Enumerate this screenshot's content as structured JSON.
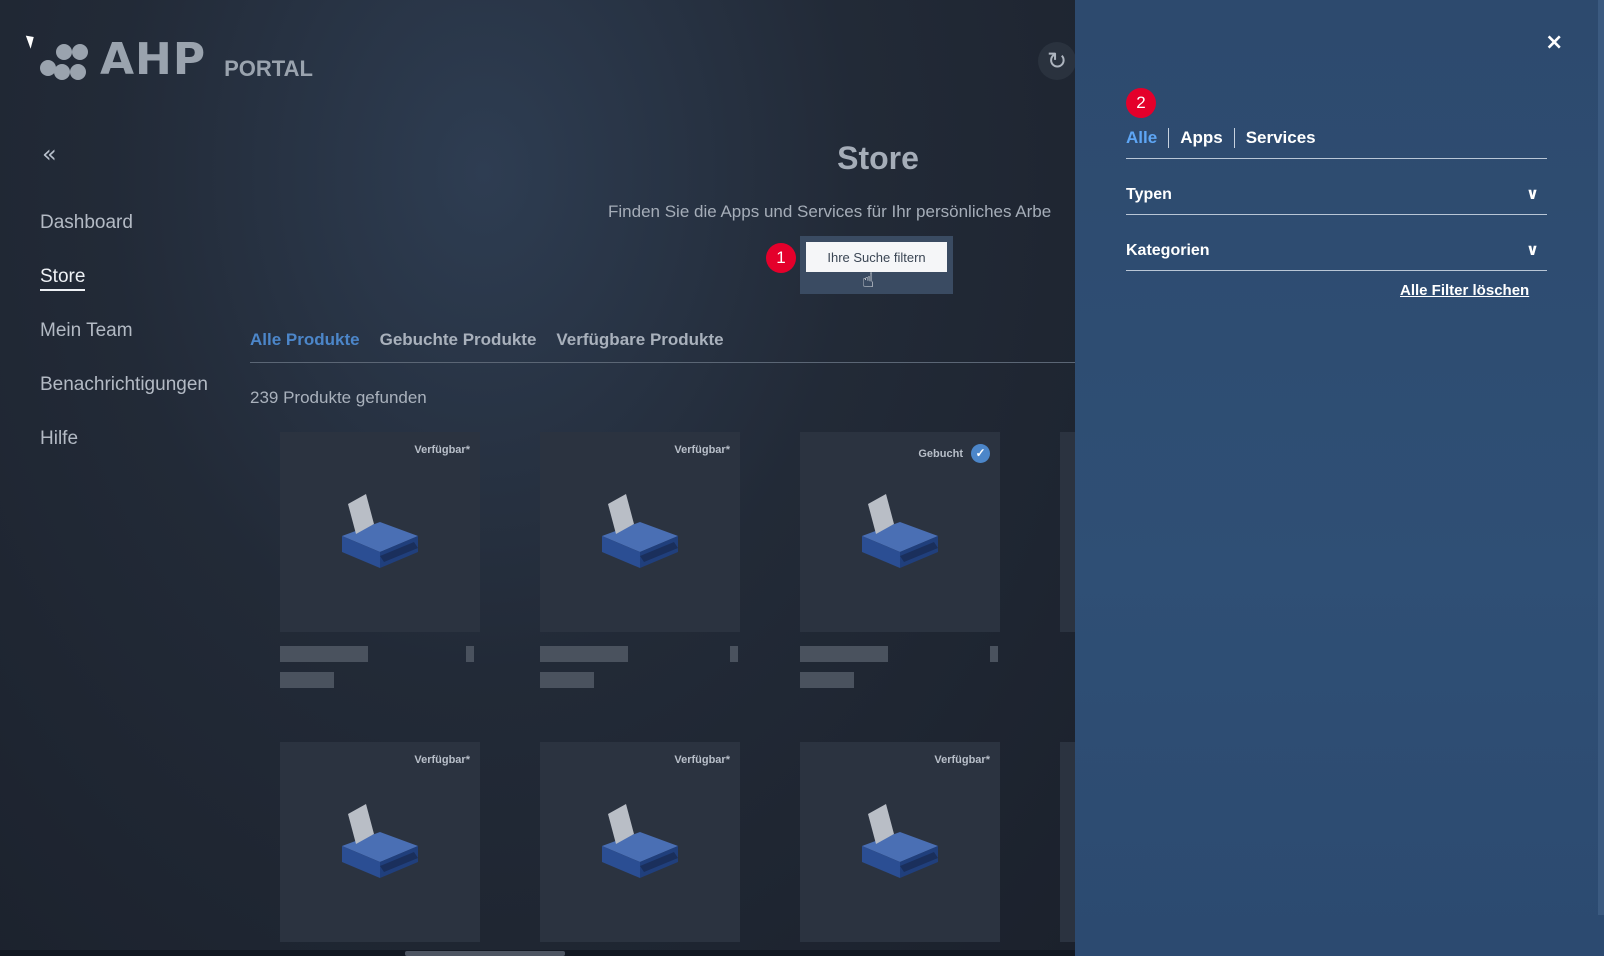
{
  "logo": {
    "mark": "AHP",
    "sub": "PORTAL"
  },
  "nav": {
    "collapse_icon": "«",
    "items": [
      {
        "label": "Dashboard",
        "active": false
      },
      {
        "label": "Store",
        "active": true
      },
      {
        "label": "Mein Team",
        "active": false
      },
      {
        "label": "Benachrichtigungen",
        "active": false
      },
      {
        "label": "Hilfe",
        "active": false
      }
    ]
  },
  "main": {
    "title": "Store",
    "description": "Finden Sie die Apps und Services für Ihr persönliches Arbe",
    "filter_button": "Ihre Suche filtern",
    "badge_1": "1",
    "tabs": [
      {
        "label": "Alle Produkte",
        "active": true
      },
      {
        "label": "Gebuchte Produkte",
        "active": false
      },
      {
        "label": "Verfügbare Produkte",
        "active": false
      }
    ],
    "count": "239 Produkte gefunden",
    "products": [
      {
        "status": "Verfügbar*",
        "booked": false
      },
      {
        "status": "Verfügbar*",
        "booked": false
      },
      {
        "status": "Gebucht",
        "booked": true
      },
      {
        "status": "Verfügbar*",
        "booked": false
      },
      {
        "status": "Verfügbar*",
        "booked": false
      },
      {
        "status": "Verfügbar*",
        "booked": false
      }
    ]
  },
  "panel": {
    "close_icon": "×",
    "badge_2": "2",
    "tabs": [
      {
        "label": "Alle",
        "active": true
      },
      {
        "label": "Apps",
        "active": false
      },
      {
        "label": "Services",
        "active": false
      }
    ],
    "sections": [
      "Typen",
      "Kategorien"
    ],
    "clear_label": "Alle Filter löschen"
  },
  "colors": {
    "accent": "#4c86c9",
    "panel": "#2f4f75",
    "badge": "#e4002b"
  }
}
